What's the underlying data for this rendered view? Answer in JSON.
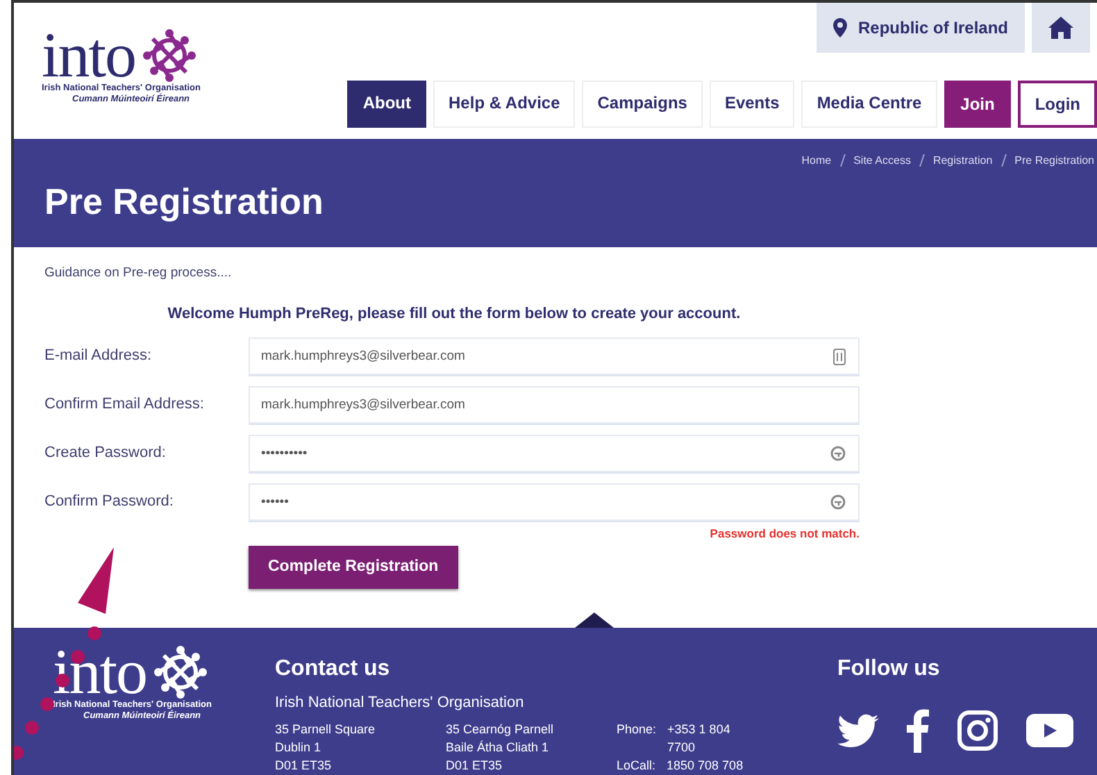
{
  "header": {
    "logo": {
      "wordmark": "into",
      "line_1": "Irish National Teachers' Organisation",
      "line_2": "Cumann Múinteoirí Éireann"
    },
    "region": "Republic of Ireland",
    "nav": [
      {
        "label": "About",
        "selected": true,
        "kind": "tab"
      },
      {
        "label": "Help & Advice",
        "selected": false,
        "kind": "tab"
      },
      {
        "label": "Campaigns",
        "selected": false,
        "kind": "tab"
      },
      {
        "label": "Events",
        "selected": false,
        "kind": "tab"
      },
      {
        "label": "Media Centre",
        "selected": false,
        "kind": "tab"
      },
      {
        "label": "Join",
        "selected": false,
        "kind": "join"
      },
      {
        "label": "Login",
        "selected": false,
        "kind": "login"
      }
    ]
  },
  "banner": {
    "breadcrumbs": [
      "Home",
      "Site Access",
      "Registration",
      "Pre Registration"
    ],
    "title": "Pre Registration"
  },
  "content": {
    "guidance": "Guidance on Pre-reg process....",
    "welcome": "Welcome Humph PreReg, please fill out the form below to create your account.",
    "fields": [
      {
        "label": "E-mail Address:",
        "value": "mark.humphreys3@silverbear.com",
        "kind": "card"
      },
      {
        "label": "Confirm Email Address:",
        "value": "mark.humphreys3@silverbear.com",
        "kind": "plain"
      },
      {
        "label": "Create Password:",
        "value": "••••••••••",
        "kind": "key"
      },
      {
        "label": "Confirm Password:",
        "value": "••••••",
        "kind": "key",
        "error": "Password does not match."
      }
    ],
    "submit": "Complete Registration"
  },
  "footer": {
    "logo": {
      "wordmark": "into",
      "line_1": "Irish National Teachers' Organisation",
      "line_2": "Cumann Múinteoirí Éireann"
    },
    "contact_title": "Contact us",
    "organisation": "Irish National Teachers' Organisation",
    "address_columns": [
      [
        "35 Parnell Square",
        "Dublin 1",
        "D01 ET35"
      ],
      [
        "35 Cearnóg Parnell",
        "Baile Átha Cliath 1",
        "D01 ET35"
      ]
    ],
    "phones": [
      {
        "label": "Phone:",
        "number": "+353 1 804 7700"
      },
      {
        "label": "LoCall:",
        "number": "1850 708 708"
      }
    ],
    "follow_title": "Follow us",
    "social": [
      {
        "kind": "twitter"
      },
      {
        "kind": "facebook"
      },
      {
        "kind": "instagram"
      },
      {
        "kind": "youtube"
      }
    ]
  }
}
